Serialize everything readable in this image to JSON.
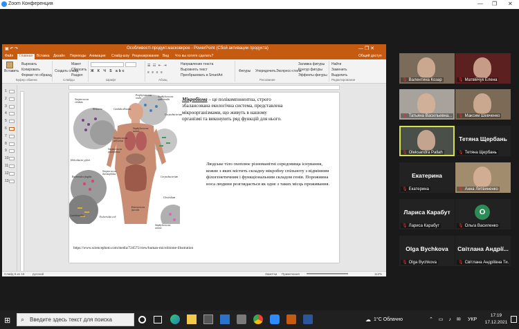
{
  "zoom": {
    "window_title": "Zoom Конференция",
    "minimize": "—",
    "restore": "❐",
    "close": "✕"
  },
  "ppt": {
    "title": "Особливості-продукт.масковкрое - PowerPoint (Сбой активации продукта)",
    "tabs": [
      "Файл",
      "Главная",
      "Вставка",
      "Дизайн",
      "Переходы",
      "Анимация",
      "Слайд-шоу",
      "Рецензирование",
      "Вид",
      "Что вы хотите сделать?"
    ],
    "share": "Общий доступ",
    "ribbon": {
      "paste": "Вставить",
      "cut": "Вырезать",
      "copy": "Копировать",
      "format_painter": "Формат по образцу",
      "clipboard_group": "Буфер обмена",
      "new_slide": "Создать слайд",
      "layout": "Макет",
      "reset": "Сбросить",
      "section": "Раздел",
      "slides_group": "Слайды",
      "font_group": "Шрифт",
      "paragraph_group": "Абзац",
      "text_direction": "Направление текста",
      "align_text": "Выровнять текст",
      "smartart": "Преобразовать в SmartArt",
      "shapes": "Фигуры",
      "arrange": "Упорядочить",
      "quick_styles": "Экспресс-стили",
      "drawing_group": "Рисование",
      "shape_fill": "Заливка фигуры",
      "shape_outline": "Контур фигуры",
      "shape_effects": "Эффекты фигуры",
      "find": "Найти",
      "replace": "Заменить",
      "select": "Выделить",
      "editing_group": "Редактирование"
    },
    "status": {
      "slide": "Слайд 6 из 16",
      "lang": "русский",
      "notes": "Заметки",
      "comments": "Примечания",
      "zoom": "112%"
    },
    "slide": {
      "para1_bold": "Мікробіома",
      "para1_rest": " – це полікомпонентна, строго збалансована екологічна система, представлена мікроорганізмами, що живуть в нашому організмі та виконують ряд функцій для нього.",
      "para2": "Людське тіло охоплює різноманітні середовища існування, кожне з яких містить складну мікробну спільноту з відмінним філогенетичним і функціональним складом генів. Порожнина носа людини розглядається як одне з таких місць проживання.",
      "source": "https://www.sciencephoto.com/media/724575/view/human-microbiome-illustration",
      "labels": [
        "Streptococcus viridans",
        "Neisseria",
        "Candida albicans",
        "Porphyromonas oralis",
        "Staphylococcus epidermidis",
        "Corynebacterium",
        "Streptococcus salivarius",
        "Staphylococcus aureus",
        "Streptococcus pneumoniae",
        "Helicobacter pylori",
        "Streptococcus thermophilus",
        "Bacteroides fragilis",
        "Lactobacillus",
        "Escherichia coli",
        "Enterococcus faecalis",
        "Clostridium",
        "Corynebacterium",
        "Staphylococcus aureus"
      ]
    },
    "slide_numbers": [
      "1",
      "2",
      "3",
      "4",
      "5",
      "6",
      "7",
      "8",
      "9",
      "10",
      "11",
      "12",
      "13"
    ]
  },
  "participants": [
    {
      "name": "Валентина Козар",
      "video": true
    },
    {
      "name": "Матвійчук Елена",
      "video": true
    },
    {
      "name": "Татьяна Васильевна...",
      "video": true
    },
    {
      "name": "Максим Шевченко",
      "video": true
    },
    {
      "name": "Oleksandra Pallah",
      "video": true
    },
    {
      "name": "Тетяна Щербань",
      "video": false,
      "display": "Тетяна Щербань"
    },
    {
      "name": "Екатерина",
      "video": false,
      "display": "Екатерина"
    },
    {
      "name": "Анна Литвиненко",
      "video": true
    },
    {
      "name": "Лариса Карабут",
      "video": false,
      "display": "Лариса Карабут"
    },
    {
      "name": "Ольга Василенко",
      "video": false,
      "display": "O"
    },
    {
      "name": "Olga Bychkova",
      "video": false,
      "display": "Olga Bychkova"
    },
    {
      "name": "Світлана Андріївна Ти...",
      "video": false,
      "display": "Світлана Андрії..."
    }
  ],
  "taskbar": {
    "search_placeholder": "Введите здесь текст для поиска",
    "weather": "1°C Облачно",
    "lang": "УКР",
    "time": "17:19",
    "date": "17.12.2021"
  }
}
